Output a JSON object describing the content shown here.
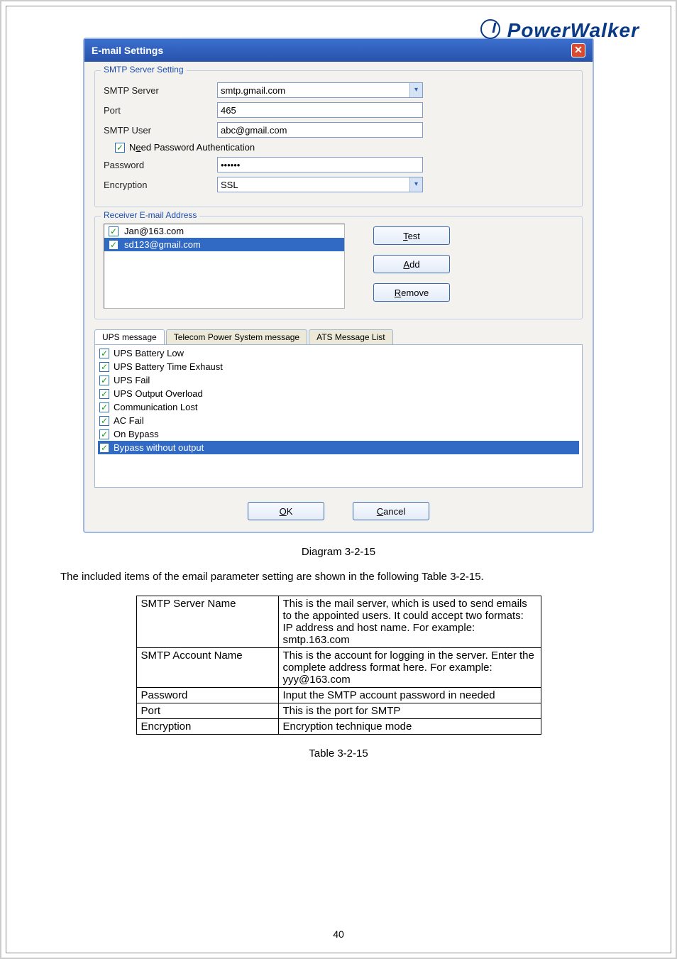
{
  "brand": "PowerWalker",
  "dialog": {
    "title": "E-mail Settings",
    "smtp_legend": "SMTP Server Setting",
    "labels": {
      "smtp_server": "SMTP Server",
      "port": "Port",
      "smtp_user": "SMTP User",
      "need_auth": "Need Password Authentication",
      "password": "Password",
      "encryption": "Encryption"
    },
    "values": {
      "smtp_server": "smtp.gmail.com",
      "port": "465",
      "smtp_user": "abc@gmail.com",
      "password": "••••••",
      "encryption": "SSL"
    },
    "receiver_legend": "Receiver E-mail Address",
    "receivers": {
      "item0": "Jan@163.com",
      "item1": "sd123@gmail.com"
    },
    "side_buttons": {
      "test": "Test",
      "add": "Add",
      "remove": "Remove"
    },
    "tabs": {
      "t0": "UPS message",
      "t1": "Telecom Power System message",
      "t2": "ATS Message List"
    },
    "messages": {
      "m0": "UPS Battery Low",
      "m1": "UPS Battery Time Exhaust",
      "m2": "UPS Fail",
      "m3": "UPS Output Overload",
      "m4": "Communication Lost",
      "m5": "AC Fail",
      "m6": "On Bypass",
      "m7": "Bypass without output"
    },
    "ok": "OK",
    "cancel": "Cancel"
  },
  "captions": {
    "diagram": "Diagram 3-2-15",
    "table": "Table 3-2-15"
  },
  "description": "The included items of the email parameter setting are shown in the following Table 3-2-15.",
  "table": {
    "row0": {
      "k": "SMTP Server Name",
      "v": "This is the mail server, which is used to send emails to the appointed users. It could accept two formats: IP address and host name. For example: smtp.163.com"
    },
    "row1": {
      "k": "SMTP Account Name",
      "v": "This is the account for logging in the server. Enter the complete address format here. For example: yyy@163.com"
    },
    "row2": {
      "k": "Password",
      "v": "Input the SMTP account password in needed"
    },
    "row3": {
      "k": "Port",
      "v": "This is the port for SMTP"
    },
    "row4": {
      "k": "Encryption",
      "v": "Encryption technique mode"
    }
  },
  "page_number": "40"
}
